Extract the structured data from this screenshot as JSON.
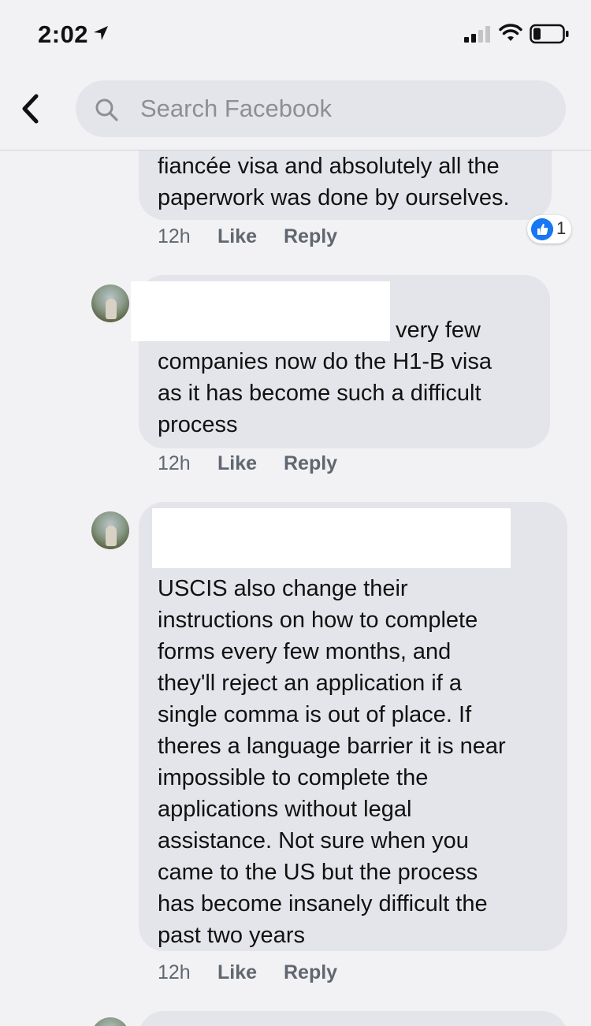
{
  "status_bar": {
    "time": "2:02",
    "icons": [
      "location-arrow-icon",
      "signal-icon",
      "wifi-icon",
      "battery-icon"
    ]
  },
  "header": {
    "back_icon": "chevron-left-icon",
    "search": {
      "placeholder": "Search Facebook",
      "icon": "search-icon"
    }
  },
  "comments": [
    {
      "lines": [
        "fiancée visa and absolutely all the",
        "paperwork was done by ourselves."
      ],
      "time": "12h",
      "like": "Like",
      "reply": "Reply",
      "reactions": {
        "icon": "thumbs-up-icon",
        "count": "1"
      }
    },
    {
      "lines": [
        "very few",
        "companies now do the H1-B visa",
        "as it has become such a difficult",
        "process"
      ],
      "time": "12h",
      "like": "Like",
      "reply": "Reply"
    },
    {
      "lines": [
        "USCIS also change their",
        "instructions on how to complete",
        "forms every few months, and",
        "they'll reject an application if a",
        "single comma is out of place. If",
        "theres a language barrier it is near",
        "impossible to complete the",
        "applications without legal",
        "assistance. Not sure when you",
        "came to the US but the process",
        "has become insanely difficult the",
        "past two years"
      ],
      "time": "12h",
      "like": "Like",
      "reply": "Reply"
    }
  ],
  "colors": {
    "background": "#f2f2f4",
    "bubble": "#e4e5ea",
    "like_blue": "#1877f2",
    "meta_text": "#606770"
  }
}
